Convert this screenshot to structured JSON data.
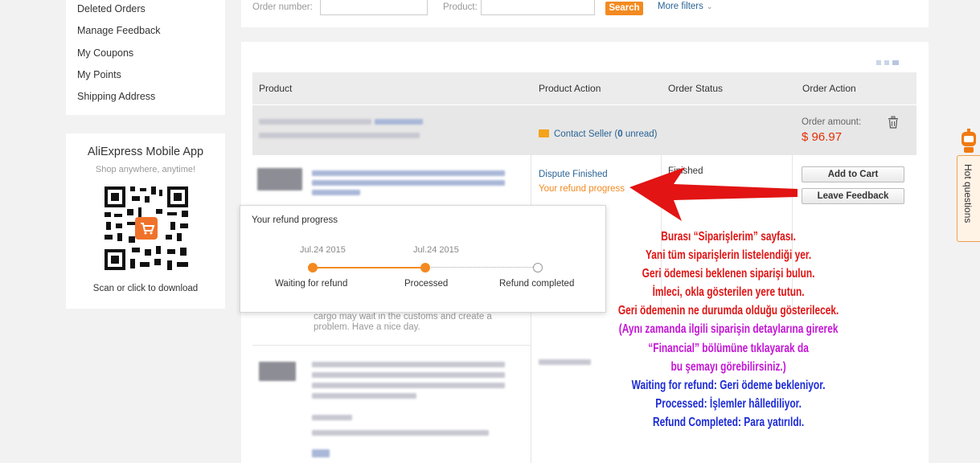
{
  "sidebar": {
    "menu": [
      "Deleted Orders",
      "Manage Feedback",
      "My Coupons",
      "My Points",
      "Shipping Address"
    ],
    "app": {
      "title": "AliExpress Mobile App",
      "subtitle": "Shop anywhere, anytime!",
      "scan": "Scan or click to download"
    }
  },
  "search": {
    "order_number_label": "Order number:",
    "product_label": "Product:",
    "search_button": "Search",
    "more_filters": "More filters"
  },
  "table": {
    "headers": [
      "Product",
      "Product Action",
      "Order Status",
      "Order Action"
    ]
  },
  "order": {
    "contact_seller": "Contact Seller (",
    "unread_count": "0",
    "unread_label": " unread)",
    "amount_label": "Order amount:",
    "amount_value": "$ 96.97",
    "dispute_status": "Dispute Finished",
    "refund_link": "Your refund progress",
    "status": "Finished",
    "add_to_cart": "Add to Cart",
    "leave_feedback": "Leave Feedback",
    "cargo_note": "cargo may wait in the customs and create a problem. Have a nice day."
  },
  "refund_popover": {
    "title": "Your refund progress",
    "steps": [
      {
        "date": "Jul.24 2015",
        "label": "Waiting for refund"
      },
      {
        "date": "Jul.24 2015",
        "label": "Processed"
      },
      {
        "date": "",
        "label": "Refund completed"
      }
    ]
  },
  "annotation": {
    "red_lines": [
      "Burası “Siparişlerim” sayfası.",
      "Yani tüm siparişlerin listelendiği yer.",
      "Geri ödemesi beklenen siparişi bulun.",
      "İmleci, okla gösterilen yere tutun.",
      "Geri ödemenin ne durumda olduğu gösterilecek."
    ],
    "magenta_lines": [
      "(Aynı zamanda ilgili siparişin detaylarına girerek",
      "“Financial” bölümüne tıklayarak da",
      "bu şemayı görebilirsiniz.)"
    ],
    "blue_lines": [
      "Waiting for refund: Geri ödeme bekleniyor.",
      "Processed: İşlemler hâllediliyor.",
      "Refund Completed: Para yatırıldı."
    ]
  },
  "hot_questions": "Hot questions",
  "colors": {
    "accent_orange": "#f38a20",
    "price_red": "#e62e04",
    "link_blue": "#2a6496",
    "annotation_red": "#e01414",
    "annotation_magenta": "#c415d6",
    "annotation_blue": "#1c2bd6"
  }
}
